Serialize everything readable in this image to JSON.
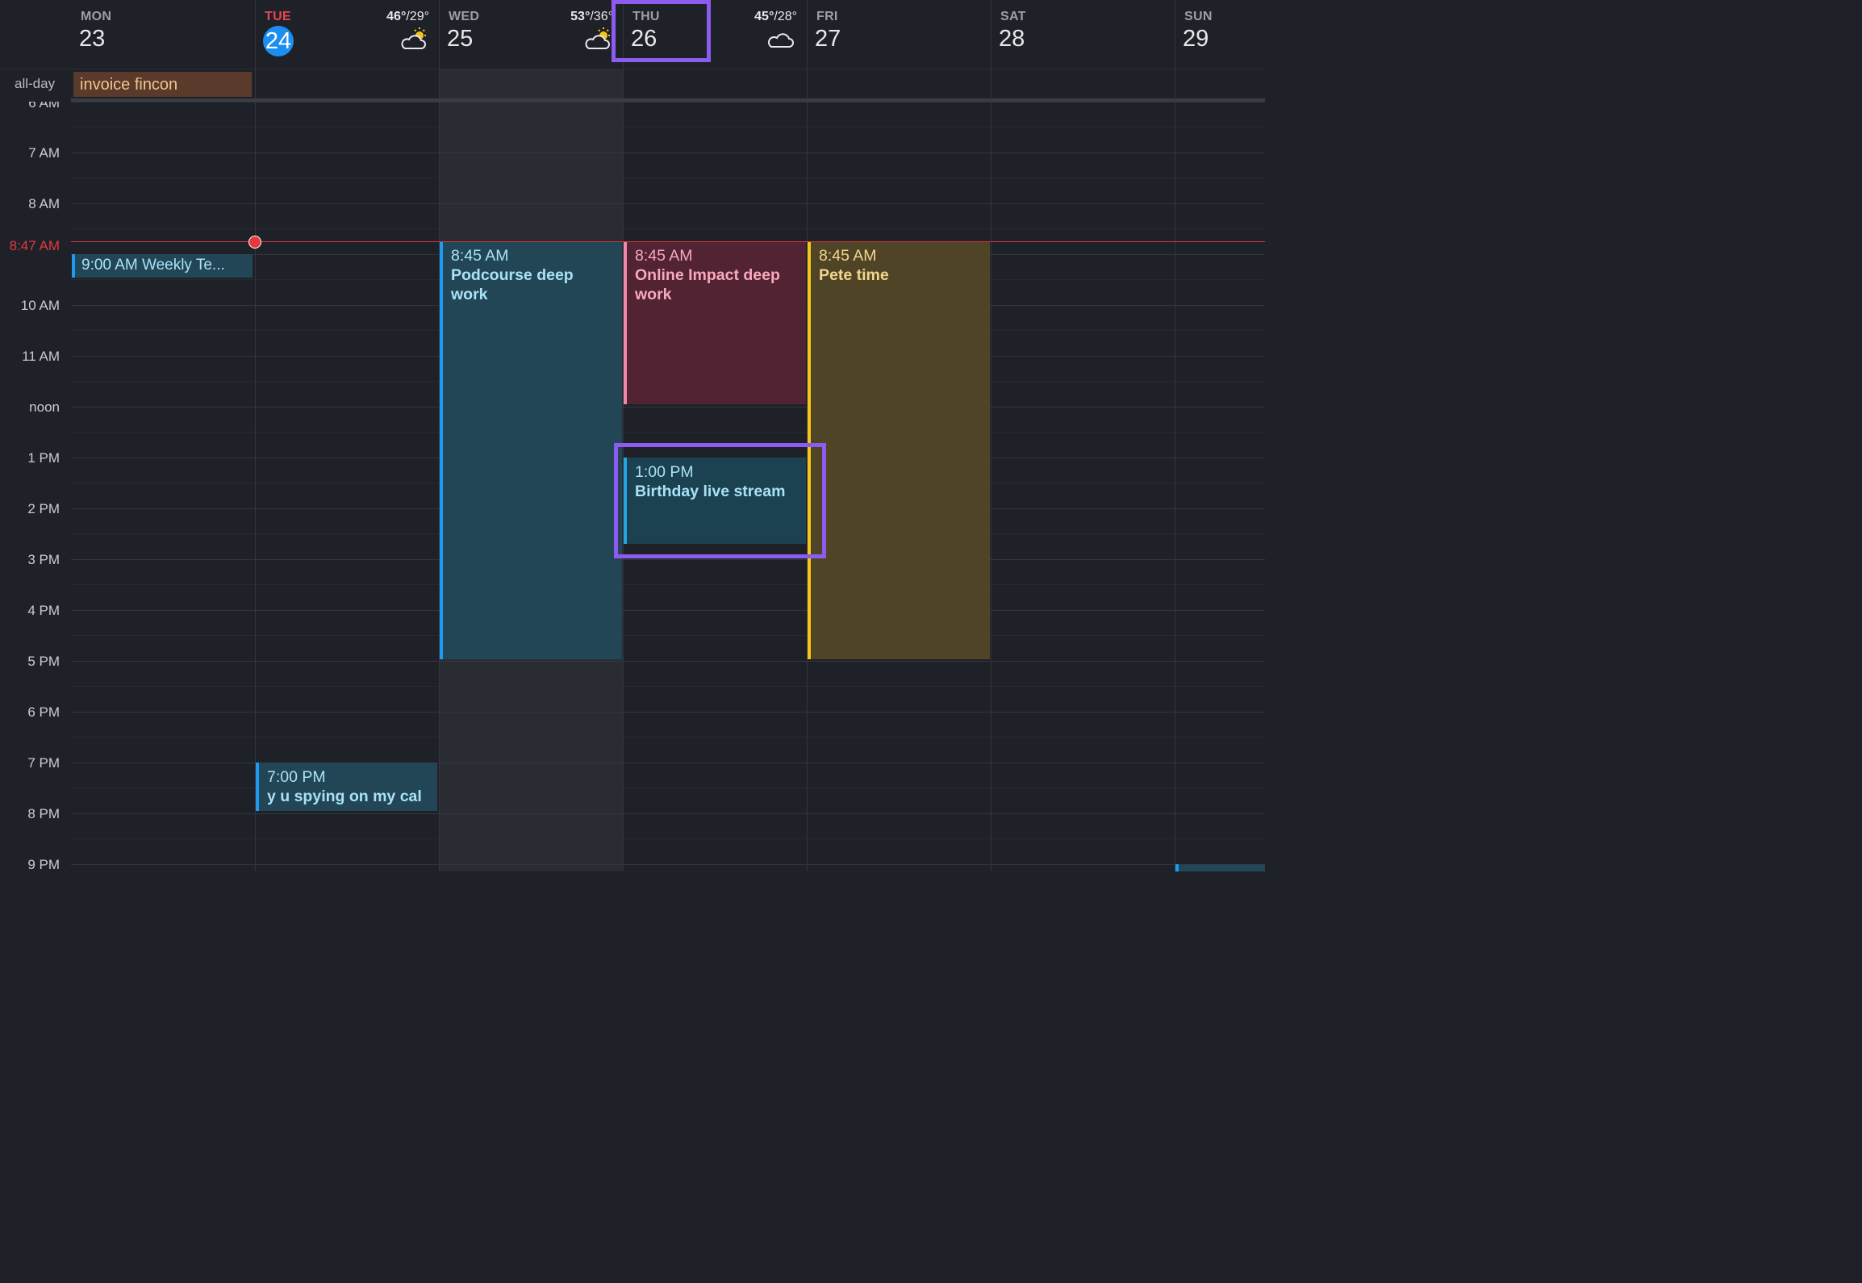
{
  "days": [
    {
      "dow": "MON",
      "num": "23",
      "temp_hi": "",
      "temp_lo": "",
      "weather_icon": ""
    },
    {
      "dow": "TUE",
      "num": "24",
      "temp_hi": "46°",
      "temp_lo": "/29°",
      "weather_icon": "partly-sunny-icon",
      "today": true
    },
    {
      "dow": "WED",
      "num": "25",
      "temp_hi": "53°",
      "temp_lo": "/36°",
      "weather_icon": "partly-sunny-icon"
    },
    {
      "dow": "THU",
      "num": "26",
      "temp_hi": "45°",
      "temp_lo": "/28°",
      "weather_icon": "cloud-icon"
    },
    {
      "dow": "FRI",
      "num": "27",
      "temp_hi": "",
      "temp_lo": "",
      "weather_icon": ""
    },
    {
      "dow": "SAT",
      "num": "28",
      "temp_hi": "",
      "temp_lo": "",
      "weather_icon": ""
    },
    {
      "dow": "SUN",
      "num": "29",
      "temp_hi": "",
      "temp_lo": "",
      "weather_icon": ""
    }
  ],
  "allday": {
    "label": "all-day",
    "event": "invoice fincon"
  },
  "time_labels": [
    "6 AM",
    "7 AM",
    "8 AM",
    "10 AM",
    "11 AM",
    "noon",
    "1 PM",
    "2 PM",
    "3 PM",
    "4 PM",
    "5 PM",
    "6 PM",
    "7 PM",
    "8 PM",
    "9 PM"
  ],
  "now_label": "8:47 AM",
  "events": {
    "weekly": {
      "text": "9:00 AM Weekly Te..."
    },
    "podcourse": {
      "time": "8:45 AM",
      "name": "Podcourse deep work"
    },
    "online_impact": {
      "time": "8:45 AM",
      "name": "Online Impact deep work"
    },
    "pete": {
      "time": "8:45 AM",
      "name": "Pete time"
    },
    "birthday": {
      "time": "1:00 PM",
      "name": "Birthday live stream"
    },
    "spying": {
      "time": "7:00 PM",
      "name": "y u spying on my cal"
    }
  },
  "colors": {
    "accent_today": "#1b8ef2",
    "now_red": "#e5393e",
    "highlight": "#8c5cf0"
  }
}
